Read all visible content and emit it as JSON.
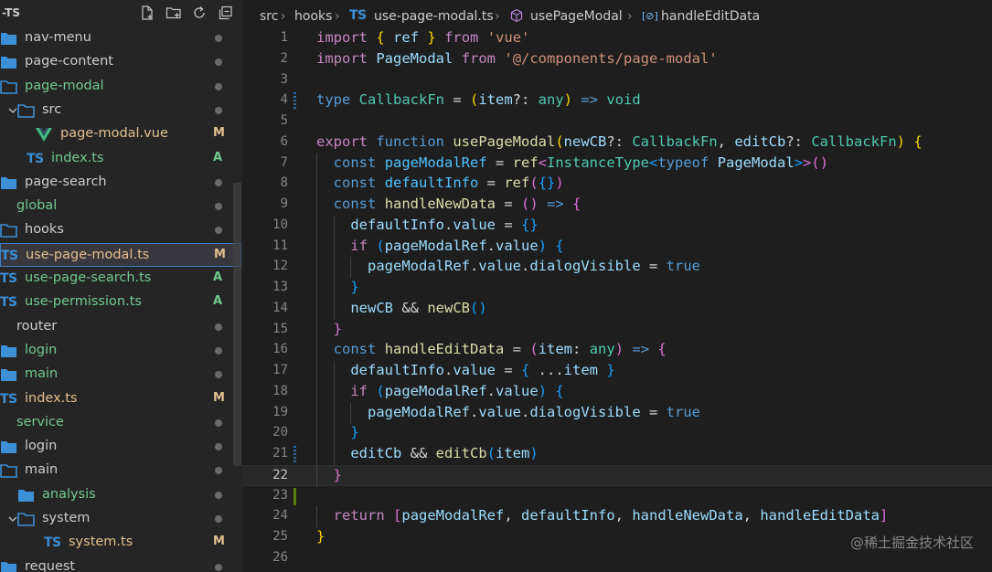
{
  "sidebar": {
    "title": "-TS",
    "actions": [
      "new-file-icon",
      "new-folder-icon",
      "refresh-icon",
      "collapse-all-icon"
    ],
    "items": [
      {
        "label": "nav-menu",
        "kind": "folder",
        "indent": 0,
        "status": "dot",
        "color": "#cccccc"
      },
      {
        "label": "page-content",
        "kind": "folder",
        "indent": 0,
        "status": "dot",
        "color": "#cccccc"
      },
      {
        "label": "page-modal",
        "kind": "folder-open",
        "indent": 0,
        "status": "dot",
        "color": "#73c991"
      },
      {
        "label": "src",
        "kind": "folder-open",
        "indent": 1,
        "status": "dot",
        "color": "#cccccc"
      },
      {
        "label": "page-modal.vue",
        "kind": "vue",
        "indent": 2,
        "status": "M",
        "color": "#e2c08d"
      },
      {
        "label": "index.ts",
        "kind": "ts",
        "indent": 1,
        "status": "A",
        "color": "#73c991"
      },
      {
        "label": "page-search",
        "kind": "folder",
        "indent": 0,
        "status": "dot",
        "color": "#cccccc"
      },
      {
        "label": "global",
        "kind": "none",
        "indent": 0,
        "status": "dot",
        "color": "#73c991"
      },
      {
        "label": "hooks",
        "kind": "folder-open",
        "indent": 0,
        "status": "dot",
        "color": "#cccccc"
      },
      {
        "label": "use-page-modal.ts",
        "kind": "ts",
        "indent": 0,
        "status": "M",
        "color": "#e2c08d",
        "selected": true
      },
      {
        "label": "use-page-search.ts",
        "kind": "ts",
        "indent": 0,
        "status": "A",
        "color": "#73c991"
      },
      {
        "label": "use-permission.ts",
        "kind": "ts",
        "indent": 0,
        "status": "A",
        "color": "#73c991"
      },
      {
        "label": "router",
        "kind": "none",
        "indent": 0,
        "status": "dot",
        "color": "#cccccc"
      },
      {
        "label": "login",
        "kind": "folder",
        "indent": 0,
        "status": "dot",
        "color": "#73c991"
      },
      {
        "label": "main",
        "kind": "folder",
        "indent": 0,
        "status": "dot",
        "color": "#73c991"
      },
      {
        "label": "index.ts",
        "kind": "ts",
        "indent": 0,
        "status": "M",
        "color": "#e2c08d"
      },
      {
        "label": "service",
        "kind": "none",
        "indent": 0,
        "status": "dot",
        "color": "#73c991"
      },
      {
        "label": "login",
        "kind": "folder",
        "indent": 0,
        "status": "dot",
        "color": "#cccccc"
      },
      {
        "label": "main",
        "kind": "folder-open",
        "indent": 0,
        "status": "dot",
        "color": "#cccccc"
      },
      {
        "label": "analysis",
        "kind": "folder",
        "indent": 1,
        "status": "dot",
        "color": "#73c991"
      },
      {
        "label": "system",
        "kind": "folder-open",
        "indent": 1,
        "status": "dot",
        "color": "#cccccc"
      },
      {
        "label": "system.ts",
        "kind": "ts",
        "indent": 2,
        "status": "M",
        "color": "#e2c08d"
      },
      {
        "label": "request",
        "kind": "folder",
        "indent": 0,
        "status": "dot",
        "color": "#cccccc"
      }
    ]
  },
  "breadcrumb": {
    "parts": [
      "src",
      "hooks",
      "use-page-modal.ts",
      "usePageModal",
      "handleEditData"
    ],
    "ts_badge": "TS"
  },
  "editor": {
    "current_line": 22,
    "lines": [
      {
        "n": "1",
        "tokens": [
          [
            "k",
            "import"
          ],
          [
            "p",
            " "
          ],
          [
            "b1",
            "{"
          ],
          [
            "p",
            " "
          ],
          [
            "v",
            "ref"
          ],
          [
            "p",
            " "
          ],
          [
            "b1",
            "}"
          ],
          [
            "p",
            " "
          ],
          [
            "k",
            "from"
          ],
          [
            "p",
            " "
          ],
          [
            "s",
            "'vue'"
          ]
        ]
      },
      {
        "n": "2",
        "tokens": [
          [
            "k",
            "import"
          ],
          [
            "p",
            " "
          ],
          [
            "v",
            "PageModal"
          ],
          [
            "p",
            " "
          ],
          [
            "k",
            "from"
          ],
          [
            "p",
            " "
          ],
          [
            "s",
            "'@/components/page-modal'"
          ]
        ]
      },
      {
        "n": "3",
        "tokens": []
      },
      {
        "n": "4",
        "gutter": "mod",
        "tokens": [
          [
            "kb",
            "type"
          ],
          [
            "p",
            " "
          ],
          [
            "t",
            "CallbackFn"
          ],
          [
            "p",
            " = "
          ],
          [
            "b1",
            "("
          ],
          [
            "v",
            "item"
          ],
          [
            "p",
            "?: "
          ],
          [
            "t",
            "any"
          ],
          [
            "b1",
            ")"
          ],
          [
            "p",
            " "
          ],
          [
            "kb",
            "=>"
          ],
          [
            "p",
            " "
          ],
          [
            "t",
            "void"
          ]
        ]
      },
      {
        "n": "5",
        "tokens": []
      },
      {
        "n": "6",
        "tokens": [
          [
            "k",
            "export"
          ],
          [
            "p",
            " "
          ],
          [
            "kb",
            "function"
          ],
          [
            "p",
            " "
          ],
          [
            "f",
            "usePageModal"
          ],
          [
            "b1",
            "("
          ],
          [
            "v",
            "newCB"
          ],
          [
            "p",
            "?: "
          ],
          [
            "t",
            "CallbackFn"
          ],
          [
            "p",
            ", "
          ],
          [
            "v",
            "editCb"
          ],
          [
            "p",
            "?: "
          ],
          [
            "t",
            "CallbackFn"
          ],
          [
            "b1",
            ")"
          ],
          [
            "p",
            " "
          ],
          [
            "b1",
            "{"
          ]
        ]
      },
      {
        "n": "7",
        "indent": 1,
        "tokens": [
          [
            "kb",
            "const"
          ],
          [
            "p",
            " "
          ],
          [
            "c",
            "pageModalRef"
          ],
          [
            "p",
            " = "
          ],
          [
            "f",
            "ref"
          ],
          [
            "b2",
            "<"
          ],
          [
            "t",
            "InstanceType"
          ],
          [
            "b3",
            "<"
          ],
          [
            "kb",
            "typeof"
          ],
          [
            "p",
            " "
          ],
          [
            "v",
            "PageModal"
          ],
          [
            "b3",
            ">"
          ],
          [
            "b2",
            ">"
          ],
          [
            "b2",
            "()"
          ]
        ]
      },
      {
        "n": "8",
        "indent": 1,
        "tokens": [
          [
            "kb",
            "const"
          ],
          [
            "p",
            " "
          ],
          [
            "c",
            "defaultInfo"
          ],
          [
            "p",
            " = "
          ],
          [
            "f",
            "ref"
          ],
          [
            "b2",
            "("
          ],
          [
            "b3",
            "{}"
          ],
          [
            "b2",
            ")"
          ]
        ]
      },
      {
        "n": "9",
        "indent": 1,
        "tokens": [
          [
            "kb",
            "const"
          ],
          [
            "p",
            " "
          ],
          [
            "f",
            "handleNewData"
          ],
          [
            "p",
            " = "
          ],
          [
            "b2",
            "()"
          ],
          [
            "p",
            " "
          ],
          [
            "kb",
            "=>"
          ],
          [
            "p",
            " "
          ],
          [
            "b2",
            "{"
          ]
        ]
      },
      {
        "n": "10",
        "indent": 2,
        "tokens": [
          [
            "v",
            "defaultInfo"
          ],
          [
            "p",
            "."
          ],
          [
            "v",
            "value"
          ],
          [
            "p",
            " = "
          ],
          [
            "b3",
            "{}"
          ]
        ]
      },
      {
        "n": "11",
        "indent": 2,
        "tokens": [
          [
            "k",
            "if"
          ],
          [
            "p",
            " "
          ],
          [
            "b3",
            "("
          ],
          [
            "v",
            "pageModalRef"
          ],
          [
            "p",
            "."
          ],
          [
            "v",
            "value"
          ],
          [
            "b3",
            ")"
          ],
          [
            "p",
            " "
          ],
          [
            "b3",
            "{"
          ]
        ]
      },
      {
        "n": "12",
        "indent": 3,
        "tokens": [
          [
            "v",
            "pageModalRef"
          ],
          [
            "p",
            "."
          ],
          [
            "v",
            "value"
          ],
          [
            "p",
            "."
          ],
          [
            "v",
            "dialogVisible"
          ],
          [
            "p",
            " = "
          ],
          [
            "kb",
            "true"
          ]
        ]
      },
      {
        "n": "13",
        "indent": 2,
        "tokens": [
          [
            "b3",
            "}"
          ]
        ]
      },
      {
        "n": "14",
        "indent": 2,
        "tokens": [
          [
            "v",
            "newCB"
          ],
          [
            "p",
            " && "
          ],
          [
            "f",
            "newCB"
          ],
          [
            "b3",
            "()"
          ]
        ]
      },
      {
        "n": "15",
        "indent": 1,
        "tokens": [
          [
            "b2",
            "}"
          ]
        ]
      },
      {
        "n": "16",
        "indent": 1,
        "tokens": [
          [
            "kb",
            "const"
          ],
          [
            "p",
            " "
          ],
          [
            "f",
            "handleEditData"
          ],
          [
            "p",
            " = "
          ],
          [
            "b2",
            "("
          ],
          [
            "v",
            "item"
          ],
          [
            "p",
            ": "
          ],
          [
            "t",
            "any"
          ],
          [
            "b2",
            ")"
          ],
          [
            "p",
            " "
          ],
          [
            "kb",
            "=>"
          ],
          [
            "p",
            " "
          ],
          [
            "b2",
            "{"
          ]
        ]
      },
      {
        "n": "17",
        "indent": 2,
        "tokens": [
          [
            "v",
            "defaultInfo"
          ],
          [
            "p",
            "."
          ],
          [
            "v",
            "value"
          ],
          [
            "p",
            " = "
          ],
          [
            "b3",
            "{"
          ],
          [
            "p",
            " ..."
          ],
          [
            "v",
            "item"
          ],
          [
            "p",
            " "
          ],
          [
            "b3",
            "}"
          ]
        ]
      },
      {
        "n": "18",
        "indent": 2,
        "tokens": [
          [
            "k",
            "if"
          ],
          [
            "p",
            " "
          ],
          [
            "b3",
            "("
          ],
          [
            "v",
            "pageModalRef"
          ],
          [
            "p",
            "."
          ],
          [
            "v",
            "value"
          ],
          [
            "b3",
            ")"
          ],
          [
            "p",
            " "
          ],
          [
            "b3",
            "{"
          ]
        ]
      },
      {
        "n": "19",
        "indent": 3,
        "tokens": [
          [
            "v",
            "pageModalRef"
          ],
          [
            "p",
            "."
          ],
          [
            "v",
            "value"
          ],
          [
            "p",
            "."
          ],
          [
            "v",
            "dialogVisible"
          ],
          [
            "p",
            " = "
          ],
          [
            "kb",
            "true"
          ]
        ]
      },
      {
        "n": "20",
        "indent": 2,
        "tokens": [
          [
            "b3",
            "}"
          ]
        ]
      },
      {
        "n": "21",
        "indent": 2,
        "gutter": "mod",
        "tokens": [
          [
            "v",
            "editCb"
          ],
          [
            "p",
            " && "
          ],
          [
            "f",
            "editCb"
          ],
          [
            "b3",
            "("
          ],
          [
            "v",
            "item"
          ],
          [
            "b3",
            ")"
          ]
        ]
      },
      {
        "n": "22",
        "indent": 1,
        "tokens": [
          [
            "b2",
            "}"
          ]
        ]
      },
      {
        "n": "23",
        "gutter": "add",
        "tokens": []
      },
      {
        "n": "24",
        "indent": 1,
        "tokens": [
          [
            "k",
            "return"
          ],
          [
            "p",
            " "
          ],
          [
            "b2",
            "["
          ],
          [
            "v",
            "pageModalRef"
          ],
          [
            "p",
            ", "
          ],
          [
            "v",
            "defaultInfo"
          ],
          [
            "p",
            ", "
          ],
          [
            "v",
            "handleNewData"
          ],
          [
            "p",
            ", "
          ],
          [
            "v",
            "handleEditData"
          ],
          [
            "b2",
            "]"
          ]
        ]
      },
      {
        "n": "25",
        "tokens": [
          [
            "b1",
            "}"
          ]
        ]
      },
      {
        "n": "26",
        "tokens": []
      }
    ]
  },
  "watermark": "@稀土掘金技术社区",
  "colors": {
    "folder": "#3d8fd6",
    "ts": "#3a8fd6",
    "vue": "#41b883",
    "modified": "#e2c08d",
    "added": "#73c991",
    "gutter_mod": "#2c6ea8",
    "gutter_add": "#587c0c"
  }
}
